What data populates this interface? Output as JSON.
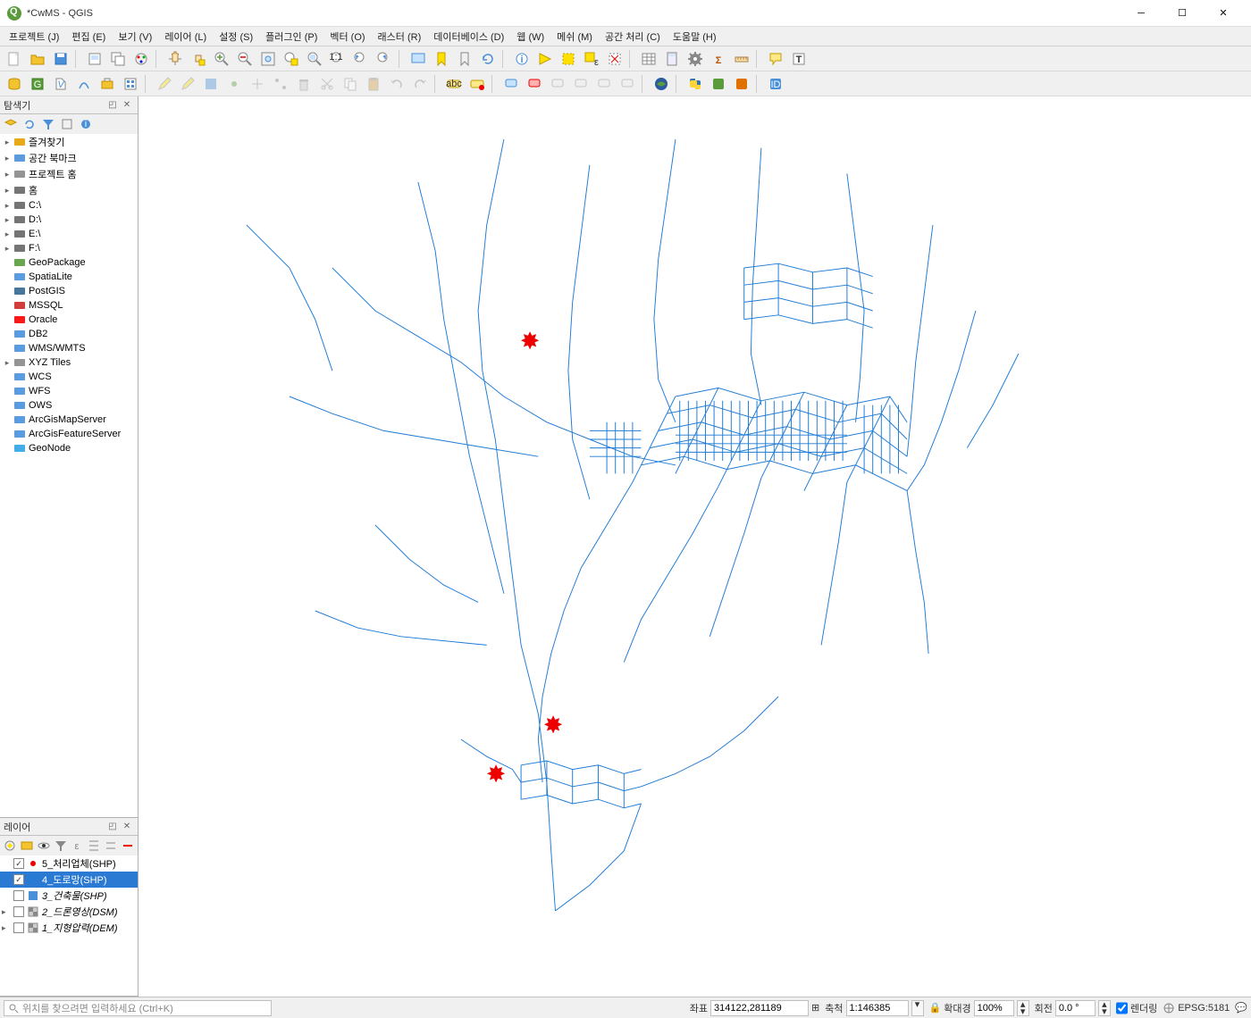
{
  "window": {
    "title": "*CwMS - QGIS"
  },
  "menus": {
    "project": "프로젝트 (J)",
    "edit": "편집 (E)",
    "view": "보기 (V)",
    "layer": "레이어 (L)",
    "settings": "설정 (S)",
    "plugins": "플러그인 (P)",
    "vector": "벡터 (O)",
    "raster": "래스터 (R)",
    "database": "데이터베이스 (D)",
    "web": "웹 (W)",
    "mesh": "메쉬 (M)",
    "processing": "공간 처리 (C)",
    "help": "도움말 (H)"
  },
  "panels": {
    "browser": {
      "title": "탐색기"
    },
    "layers": {
      "title": "레이어"
    }
  },
  "browser_items": [
    {
      "label": "즐겨찾기",
      "icon": "star",
      "color": "#e6a000",
      "expandable": true
    },
    {
      "label": "공간 북마크",
      "icon": "bookmark",
      "color": "#4a90d9",
      "expandable": true
    },
    {
      "label": "프로젝트 홈",
      "icon": "folder",
      "color": "#888",
      "expandable": true
    },
    {
      "label": "홈",
      "icon": "home",
      "color": "#666",
      "expandable": true
    },
    {
      "label": "C:\\",
      "icon": "drive",
      "color": "#666",
      "expandable": true
    },
    {
      "label": "D:\\",
      "icon": "drive",
      "color": "#666",
      "expandable": true
    },
    {
      "label": "E:\\",
      "icon": "drive",
      "color": "#666",
      "expandable": true
    },
    {
      "label": "F:\\",
      "icon": "drive",
      "color": "#666",
      "expandable": true
    },
    {
      "label": "GeoPackage",
      "icon": "gpkg",
      "color": "#5a9b3c",
      "expandable": false
    },
    {
      "label": "SpatiaLite",
      "icon": "feather",
      "color": "#4a90d9",
      "expandable": false
    },
    {
      "label": "PostGIS",
      "icon": "elephant",
      "color": "#336791",
      "expandable": false
    },
    {
      "label": "MSSQL",
      "icon": "db",
      "color": "#cc2927",
      "expandable": false
    },
    {
      "label": "Oracle",
      "icon": "db",
      "color": "#f80000",
      "expandable": false
    },
    {
      "label": "DB2",
      "icon": "db",
      "color": "#4a90d9",
      "expandable": false
    },
    {
      "label": "WMS/WMTS",
      "icon": "globe",
      "color": "#4a90d9",
      "expandable": false
    },
    {
      "label": "XYZ Tiles",
      "icon": "tiles",
      "color": "#888",
      "expandable": true
    },
    {
      "label": "WCS",
      "icon": "globe",
      "color": "#4a90d9",
      "expandable": false
    },
    {
      "label": "WFS",
      "icon": "globe",
      "color": "#4a90d9",
      "expandable": false
    },
    {
      "label": "OWS",
      "icon": "globe",
      "color": "#4a90d9",
      "expandable": false
    },
    {
      "label": "ArcGisMapServer",
      "icon": "arcgis",
      "color": "#4a90d9",
      "expandable": false
    },
    {
      "label": "ArcGisFeatureServer",
      "icon": "arcgis",
      "color": "#4a90d9",
      "expandable": false
    },
    {
      "label": "GeoNode",
      "icon": "node",
      "color": "#2fa4e7",
      "expandable": false
    }
  ],
  "layer_items": [
    {
      "checked": true,
      "name": "5_처리업체(SHP)",
      "symbol": "point-red",
      "selected": false,
      "expandable": false,
      "italic": false
    },
    {
      "checked": true,
      "name": "4_도로망(SHP)",
      "symbol": "line-blue",
      "selected": true,
      "expandable": false,
      "italic": false
    },
    {
      "checked": false,
      "name": "3_건축물(SHP)",
      "symbol": "poly-blue",
      "selected": false,
      "expandable": false,
      "italic": true
    },
    {
      "checked": false,
      "name": "2_드론영상(DSM)",
      "symbol": "raster",
      "selected": false,
      "expandable": true,
      "italic": true
    },
    {
      "checked": false,
      "name": "1_지형압력(DEM)",
      "symbol": "raster",
      "selected": false,
      "expandable": true,
      "italic": true
    }
  ],
  "status": {
    "search_placeholder": "위치를 찾으려면 입력하세요 (Ctrl+K)",
    "coord_label": "좌표",
    "coord_value": "314122,281189",
    "scale_label": "축척",
    "scale_value": "1:146385",
    "magnifier_label": "확대경",
    "magnifier_value": "100%",
    "rotation_label": "회전",
    "rotation_value": "0.0 °",
    "render_label": "렌더링",
    "crs_value": "EPSG:5181"
  },
  "colors": {
    "road": "#1e7bd6",
    "star": "#e00000"
  }
}
